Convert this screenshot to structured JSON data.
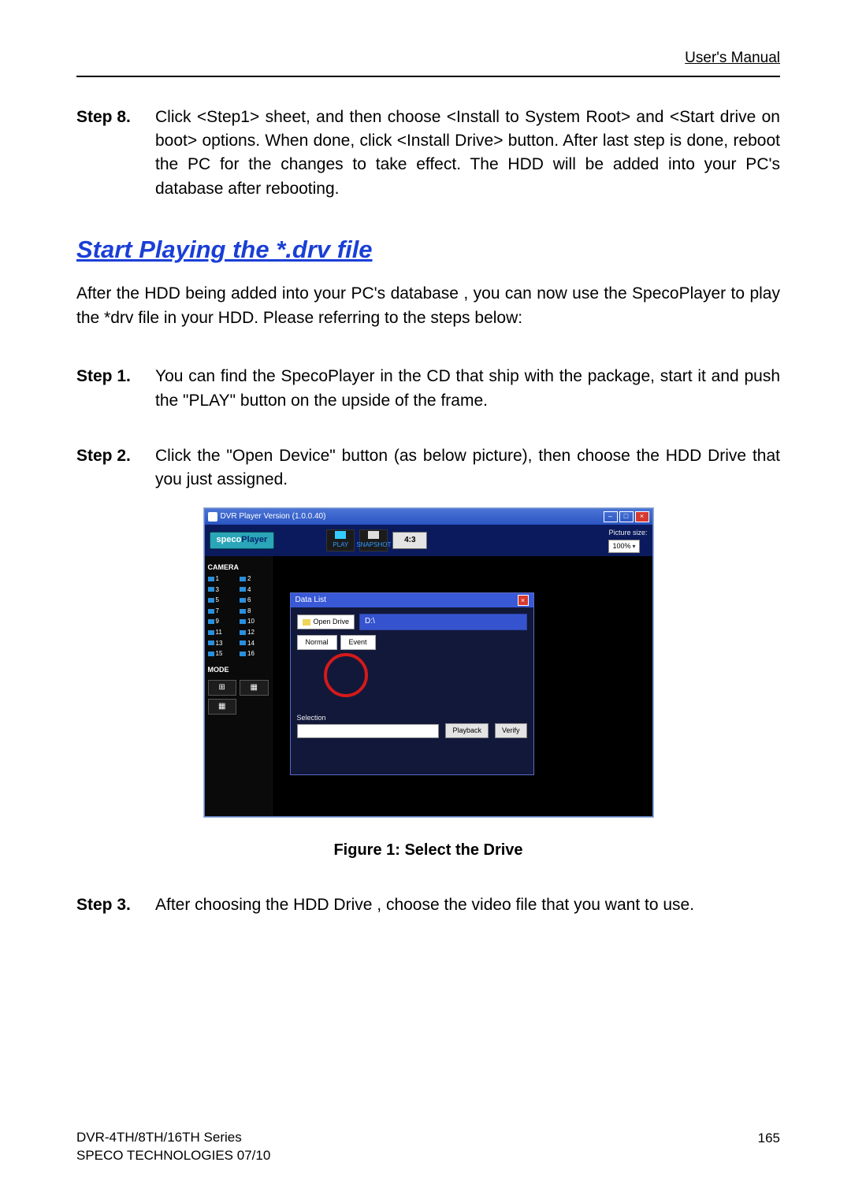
{
  "header": {
    "right": "User's Manual"
  },
  "step8": {
    "label": "Step 8.",
    "text": "Click <Step1> sheet, and then choose <Install to System Root> and <Start drive on boot> options. When done, click <Install Drive> button. After last step is done, reboot the PC for the changes to take effect. The HDD will be added into your PC's database after rebooting."
  },
  "section_title": "Start Playing the *.drv file",
  "intro": "After the HDD being added into your PC's database , you can now use the SpecoPlayer to play the *drv file in your HDD. Please referring to the steps below:",
  "step1": {
    "label": "Step 1.",
    "text": "You can find the SpecoPlayer in the CD that ship with the package, start it and push the \"PLAY\" button on the upside of the frame."
  },
  "step2": {
    "label": "Step 2.",
    "text": "Click the \"Open Device\" button (as below picture), then choose the HDD Drive that you just assigned."
  },
  "screenshot": {
    "title": "DVR Player Version (1.0.0.40)",
    "win_min": "–",
    "win_max": "□",
    "win_close": "×",
    "logo_part1": "speco",
    "logo_part2": "Player",
    "play_label": "PLAY",
    "snapshot_label": "SNAPSHOT",
    "aspect": "4:3",
    "picture_size_label": "Picture size:",
    "picture_size_value": "100%",
    "camera_label": "CAMERA",
    "cameras": [
      "1",
      "2",
      "3",
      "4",
      "5",
      "6",
      "7",
      "8",
      "9",
      "10",
      "11",
      "12",
      "13",
      "14",
      "15",
      "16"
    ],
    "mode_label": "MODE",
    "mode_icon_2x2": "⊞",
    "mode_icon_3x3": "▦",
    "mode_icon_4x4": "▦",
    "datalist_title": "Data List",
    "datalist_close": "×",
    "open_drive_label": "Open Drive",
    "drive_value": "D:\\",
    "tab_normal": "Normal",
    "tab_event": "Event",
    "selection_label": "Selection",
    "playback_btn": "Playback",
    "verify_btn": "Verify"
  },
  "figure_caption": "Figure 1: Select the Drive",
  "step3": {
    "label": "Step 3.",
    "text": "After choosing the HDD Drive , choose the video file that you want to use."
  },
  "footer": {
    "line1": "DVR-4TH/8TH/16TH Series",
    "line2": "SPECO TECHNOLOGIES 07/10",
    "page_number": "165"
  }
}
